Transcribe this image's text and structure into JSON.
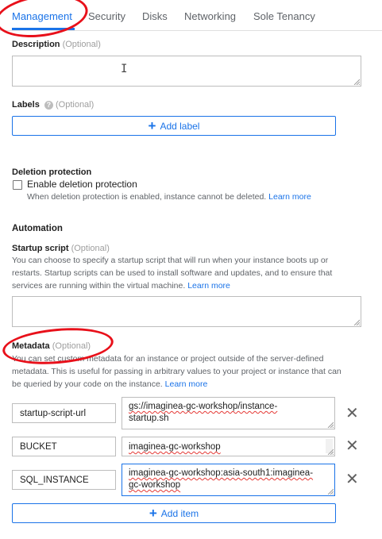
{
  "tabs": [
    {
      "label": "Management",
      "active": true
    },
    {
      "label": "Security",
      "active": false
    },
    {
      "label": "Disks",
      "active": false
    },
    {
      "label": "Networking",
      "active": false
    },
    {
      "label": "Sole Tenancy",
      "active": false
    }
  ],
  "description": {
    "label": "Description",
    "optional": "(Optional)",
    "value": ""
  },
  "labels": {
    "label": "Labels",
    "optional": "(Optional)",
    "help_icon": "help-circle-icon",
    "add_label": "Add label"
  },
  "deletion": {
    "title": "Deletion protection",
    "checkbox_label": "Enable deletion protection",
    "checked": false,
    "help_text": "When deletion protection is enabled, instance cannot be deleted.",
    "learn_more": "Learn more"
  },
  "automation": {
    "title": "Automation",
    "startup_label": "Startup script",
    "optional": "(Optional)",
    "desc_line1": "You can choose to specify a startup script that will run when your instance boots up or",
    "desc_line2": "restarts. Startup scripts can be used to install software and updates, and to ensure that",
    "desc_line3": "services are running within the virtual machine.",
    "learn_more": "Learn more",
    "value": ""
  },
  "metadata": {
    "label": "Metadata",
    "optional": "(Optional)",
    "desc_line1": "You can set custom metadata for an instance or project outside of the server-defined",
    "desc_line2": "metadata. This is useful for passing in arbitrary values to your project or instance that can",
    "desc_line3": "be queried by your code on the instance.",
    "learn_more": "Learn more",
    "items": [
      {
        "key": "startup-script-url",
        "value_line1": "gs://imaginea-gc-workshop/instance-",
        "value_line2": "startup.sh"
      },
      {
        "key": "BUCKET",
        "value_line1": "imaginea-gc-workshop",
        "value_line2": ""
      },
      {
        "key": "SQL_INSTANCE",
        "value_line1": "imaginea-gc-workshop:asia-south1:imaginea-",
        "value_line2": "gc-workshop"
      }
    ],
    "remove_icon": "close-icon",
    "add_item": "Add item"
  },
  "colors": {
    "accent": "#1a73e8",
    "annotation": "#e8101a"
  }
}
